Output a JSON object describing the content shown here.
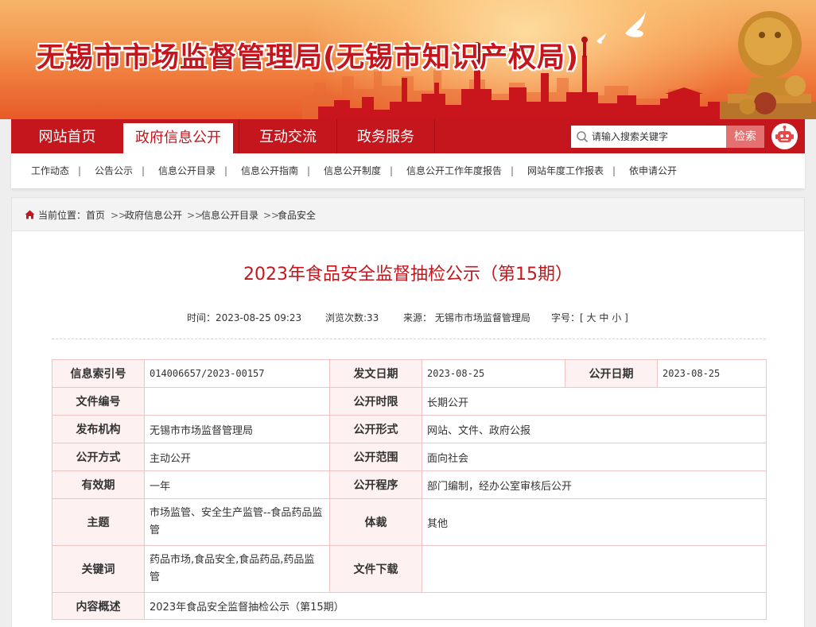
{
  "header": {
    "site_title": "无锡市市场监督管理局(无锡市知识产权局)"
  },
  "main_nav": {
    "tabs": [
      "网站首页",
      "政府信息公开",
      "互动交流",
      "政务服务"
    ],
    "active_index": 1,
    "search_placeholder": "请输入搜索关键字",
    "search_button": "检索"
  },
  "sub_nav": {
    "items": [
      "工作动态",
      "公告公示",
      "信息公开目录",
      "信息公开指南",
      "信息公开制度",
      "信息公开工作年度报告",
      "网站年度工作报表",
      "依申请公开"
    ],
    "separator": "|"
  },
  "breadcrumb": {
    "prefix": "当前位置：",
    "items": [
      "首页",
      "政府信息公开",
      "信息公开目录",
      "食品安全"
    ],
    "arrow": ">>"
  },
  "article": {
    "title": "2023年食品安全监督抽检公示（第15期）",
    "time_label": "时间：",
    "time_value": "2023-08-25 09:23",
    "views_label": "浏览次数:",
    "views_value": "33",
    "source_label": "来源：",
    "source_value": "无锡市市场监督管理局",
    "fontsize_label": "字号：",
    "fontsize_open": "[",
    "fontsize_large": "大",
    "fontsize_medium": "中",
    "fontsize_small": "小",
    "fontsize_close": "]"
  },
  "info_table": {
    "index_label": "信息索引号",
    "index_value": "014006657/2023-00157",
    "issue_date_label": "发文日期",
    "issue_date_value": "2023-08-25",
    "open_date_label": "公开日期",
    "open_date_value": "2023-08-25",
    "doc_no_label": "文件编号",
    "doc_no_value": "",
    "open_limit_label": "公开时限",
    "open_limit_value": "长期公开",
    "publisher_label": "发布机构",
    "publisher_value": "无锡市市场监督管理局",
    "open_form_label": "公开形式",
    "open_form_value": "网站、文件、政府公报",
    "open_mode_label": "公开方式",
    "open_mode_value": "主动公开",
    "open_scope_label": "公开范围",
    "open_scope_value": "面向社会",
    "validity_label": "有效期",
    "validity_value": "一年",
    "procedure_label": "公开程序",
    "procedure_value": "部门编制，经办公室审核后公开",
    "topic_label": "主题",
    "topic_value": "市场监管、安全生产监管--食品药品监管",
    "genre_label": "体裁",
    "genre_value": "其他",
    "keywords_label": "关键词",
    "keywords_value": "药品市场,食品安全,食品药品,药品监管",
    "download_label": "文件下载",
    "download_value": "",
    "summary_label": "内容概述",
    "summary_value": "2023年食品安全监督抽检公示（第15期）"
  },
  "colors": {
    "brand_red": "#c4161c",
    "label_bg": "#fdf1f1",
    "table_border": "#f0c4c4"
  },
  "icons": [
    "search-icon",
    "robot-icon",
    "home-icon",
    "dove-icon",
    "lion-statue-icon"
  ]
}
